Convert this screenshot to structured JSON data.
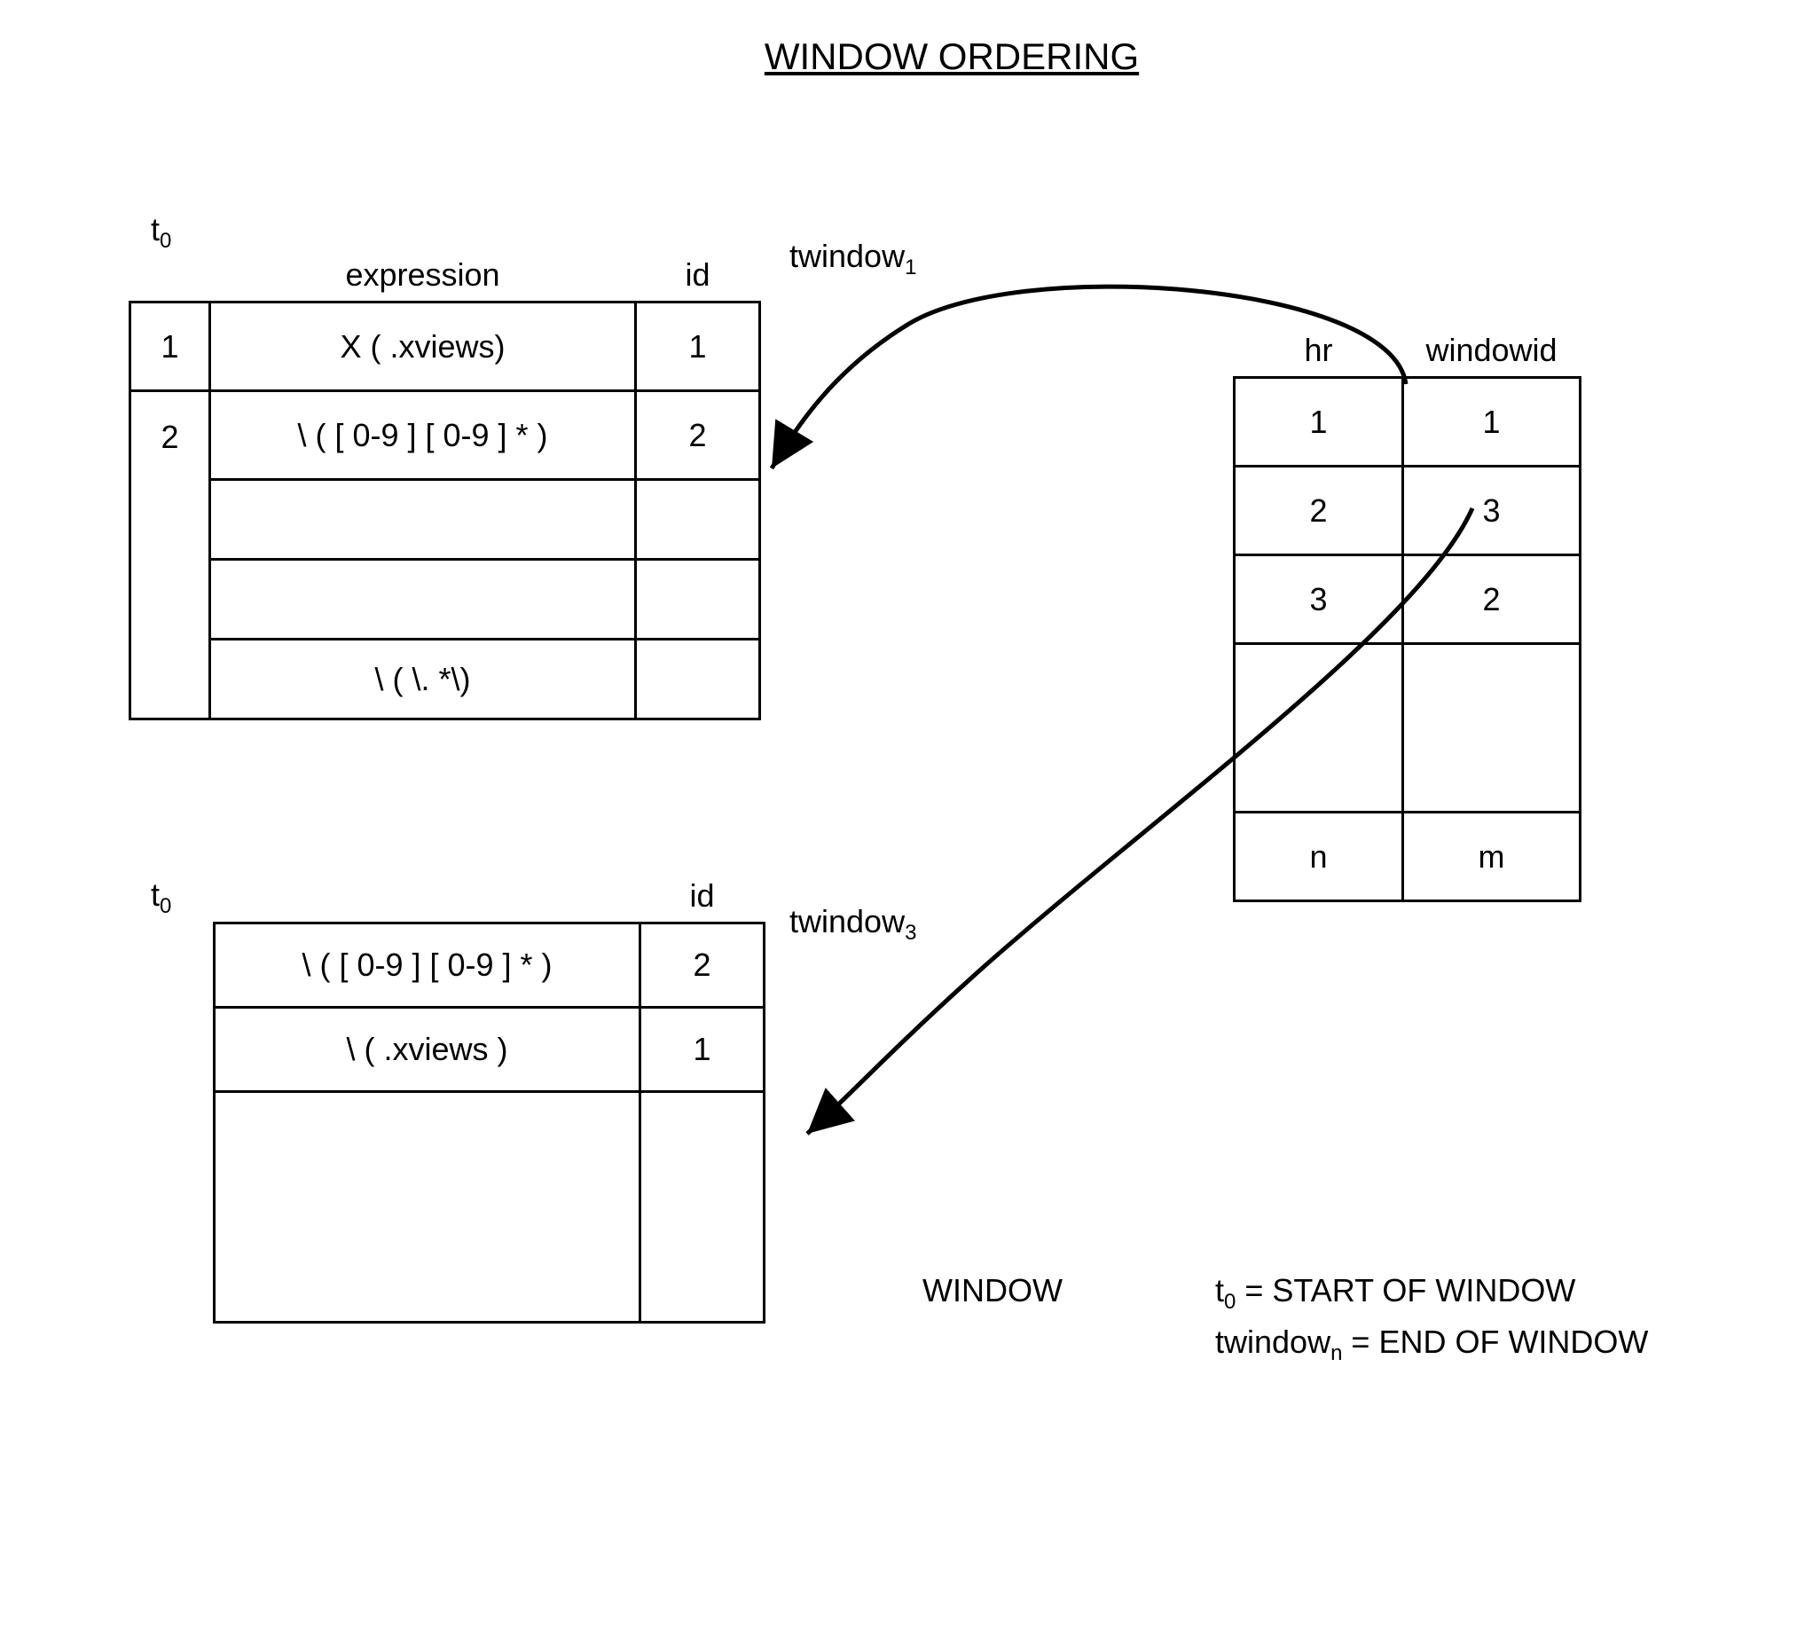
{
  "title": "WINDOW ORDERING",
  "table1": {
    "label_col0": "t",
    "label_col0_sub": "0",
    "header_expression": "expression",
    "header_id": "id",
    "side_label": "twindow",
    "side_label_sub": "1",
    "rows": [
      {
        "t": "1",
        "expr": "X ( .xviews)",
        "id": "1"
      },
      {
        "t": "2",
        "expr": "\\ ( [ 0-9 ] [ 0-9 ] * )",
        "id": "2"
      },
      {
        "t": "",
        "expr": "",
        "id": ""
      },
      {
        "t": "",
        "expr": "",
        "id": ""
      },
      {
        "t": "",
        "expr": "\\ ( \\. *\\)",
        "id": ""
      }
    ]
  },
  "table2": {
    "label_col0": "t",
    "label_col0_sub": "0",
    "header_id": "id",
    "side_label": "twindow",
    "side_label_sub": "3",
    "rows": [
      {
        "expr": "\\ ( [ 0-9 ] [ 0-9 ] * )",
        "id": "2"
      },
      {
        "expr": "\\ ( .xviews )",
        "id": "1"
      }
    ]
  },
  "table3": {
    "header_hr": "hr",
    "header_windowid": "windowid",
    "rows": [
      {
        "hr": "1",
        "wid": "1"
      },
      {
        "hr": "2",
        "wid": "3"
      },
      {
        "hr": "3",
        "wid": "2"
      },
      {
        "hr": "",
        "wid": ""
      },
      {
        "hr": "n",
        "wid": "m"
      }
    ]
  },
  "legend": {
    "left": "WINDOW",
    "line1_prefix": "t",
    "line1_sub": "0",
    "line1_rest": " = START OF WINDOW",
    "line2_prefix": "twindow",
    "line2_sub": "n",
    "line2_rest": " = END OF WINDOW"
  }
}
